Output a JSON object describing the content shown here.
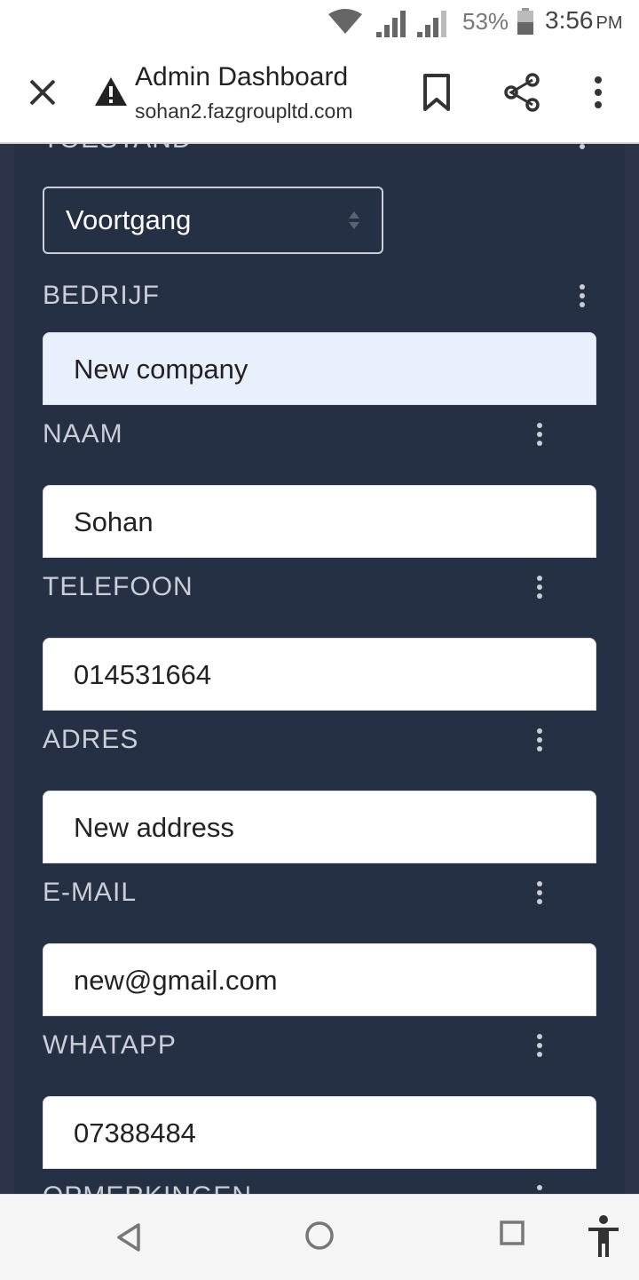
{
  "status_bar": {
    "battery_percent": "53%",
    "time": "3:56",
    "ampm": "PM",
    "icons": [
      "wifi-icon",
      "cell-signal-icon",
      "cell-signal-icon",
      "battery-icon"
    ]
  },
  "toolbar": {
    "title": "Admin Dashboard",
    "url": "sohan2.fazgroupltd.com",
    "icons": [
      "close-icon",
      "warning-icon",
      "bookmark-icon",
      "share-icon",
      "more-vert-icon"
    ]
  },
  "form": {
    "status_label_partial": "TOESTAND",
    "status_select_value": "Voortgang",
    "fields": [
      {
        "label": "BEDRIJF",
        "value": "New company",
        "autofill": true
      },
      {
        "label": "NAAM",
        "value": "Sohan"
      },
      {
        "label": "TELEFOON",
        "value": "014531664"
      },
      {
        "label": "ADRES",
        "value": "New address"
      },
      {
        "label": "E-MAIL",
        "value": "new@gmail.com"
      },
      {
        "label": "WHATAPP",
        "value": "07388484"
      }
    ],
    "next_label_partial": "OPMERKINGEN"
  },
  "colors": {
    "page_bg": "#2b3448",
    "panel_bg": "#263045",
    "label_text": "#c9ced8",
    "autofill_bg": "#e8f0fe"
  },
  "nav_bar": {
    "icons": [
      "back-icon",
      "home-icon",
      "recents-icon",
      "accessibility-icon"
    ]
  }
}
